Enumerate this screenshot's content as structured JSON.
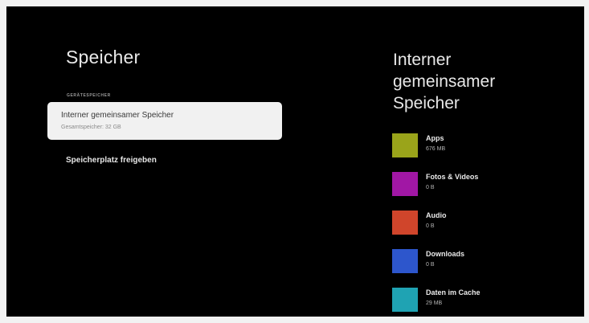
{
  "page": {
    "title": "Speicher"
  },
  "section": {
    "label": "GERÄTESPEICHER"
  },
  "storage_card": {
    "title": "Interner gemeinsamer Speicher",
    "subtitle": "Gesamtspeicher: 32 GB"
  },
  "menu": {
    "free_space": "Speicherplatz freigeben"
  },
  "panel": {
    "title": "Interner gemeinsamer Speicher",
    "categories": [
      {
        "name": "Apps",
        "size": "676 MB",
        "color": "#9aa41a"
      },
      {
        "name": "Fotos & Videos",
        "size": "0 B",
        "color": "#a117a5"
      },
      {
        "name": "Audio",
        "size": "0 B",
        "color": "#d0452b"
      },
      {
        "name": "Downloads",
        "size": "0 B",
        "color": "#2d56cc"
      },
      {
        "name": "Daten im Cache",
        "size": "29 MB",
        "color": "#1fa3b3"
      }
    ]
  }
}
